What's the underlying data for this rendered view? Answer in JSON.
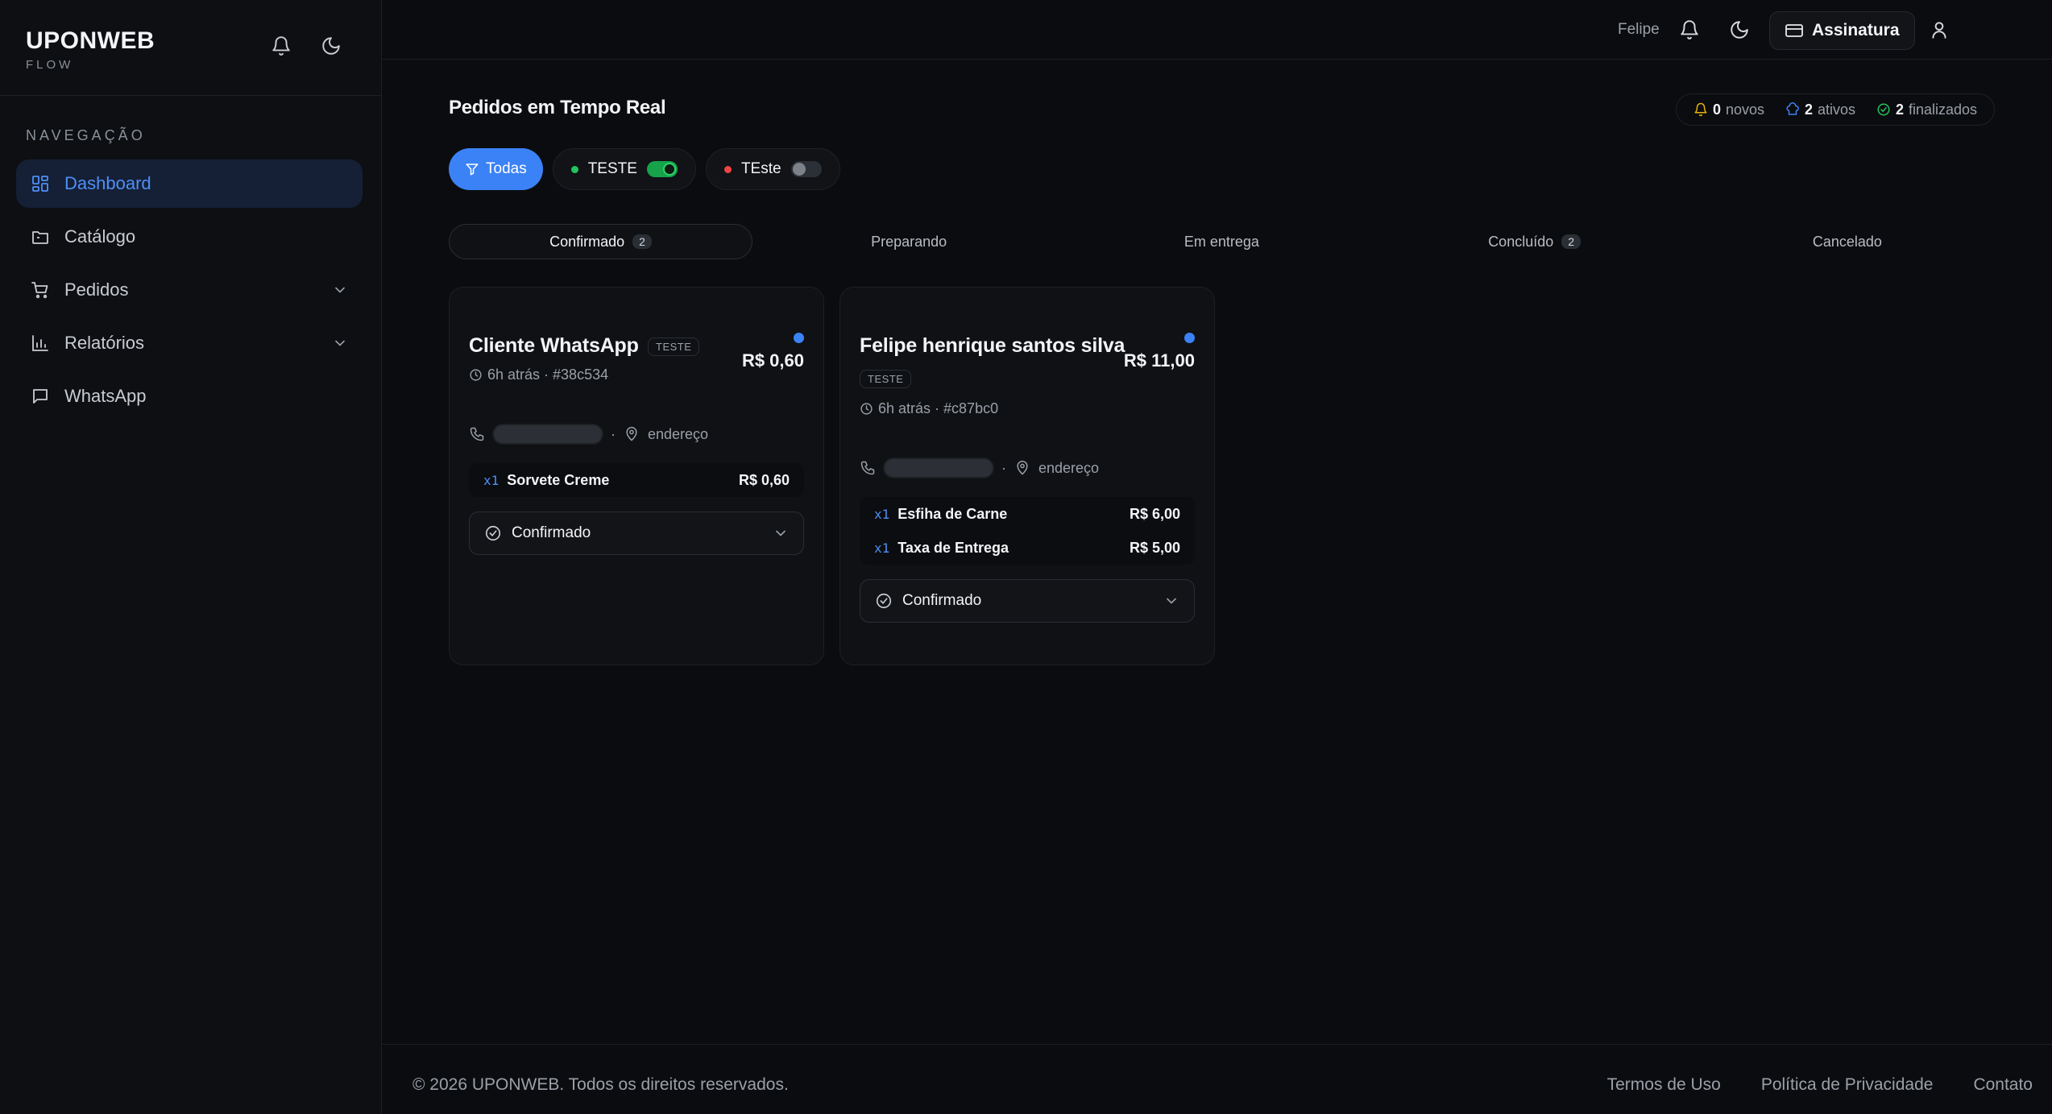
{
  "brand": {
    "name": "UPONWEB",
    "sub": "FLOW"
  },
  "sidebar": {
    "nav_title": "NAVEGAÇÃO",
    "items": [
      {
        "label": "Dashboard",
        "icon": "dashboard-icon",
        "active": true
      },
      {
        "label": "Catálogo",
        "icon": "catalog-icon"
      },
      {
        "label": "Pedidos",
        "icon": "cart-icon",
        "expandable": true
      },
      {
        "label": "Relatórios",
        "icon": "bar-chart-icon",
        "expandable": true
      },
      {
        "label": "WhatsApp",
        "icon": "message-icon"
      }
    ]
  },
  "topbar": {
    "user": "Felipe",
    "subscription": "Assinatura"
  },
  "main": {
    "title": "Pedidos em Tempo Real",
    "stats": {
      "new_count": "0",
      "new_label": "novos",
      "active_count": "2",
      "active_label": "ativos",
      "done_count": "2",
      "done_label": "finalizados"
    },
    "filters": {
      "all": "Todas",
      "chips": [
        {
          "label": "TESTE",
          "dot_color": "#22c55e",
          "enabled": true
        },
        {
          "label": "TEste",
          "dot_color": "#ef4444",
          "enabled": false
        }
      ]
    },
    "tabs": [
      {
        "label": "Confirmado",
        "badge": "2",
        "active": true
      },
      {
        "label": "Preparando"
      },
      {
        "label": "Em entrega"
      },
      {
        "label": "Concluído",
        "badge": "2"
      },
      {
        "label": "Cancelado"
      }
    ]
  },
  "orders": [
    {
      "customer": "Cliente WhatsApp",
      "tag": "TESTE",
      "price": "R$ 0,60",
      "time": "6h atrás · #38c534",
      "address": "endereço",
      "items": [
        {
          "qty": "x1",
          "name": "Sorvete Creme",
          "price": "R$ 0,60"
        }
      ],
      "status": "Confirmado"
    },
    {
      "customer": "Felipe henrique santos silva",
      "tag": "TESTE",
      "price": "R$ 11,00",
      "time": "6h atrás · #c87bc0",
      "address": "endereço",
      "items": [
        {
          "qty": "x1",
          "name": "Esfiha de Carne",
          "price": "R$ 6,00"
        },
        {
          "qty": "x1",
          "name": "Taxa de Entrega",
          "price": "R$ 5,00"
        }
      ],
      "status": "Confirmado"
    }
  ],
  "footer": {
    "copyright": "© 2026 UPONWEB. Todos os direitos reservados.",
    "links": [
      "Termos de Uso",
      "Política de Privacidade",
      "Contato"
    ]
  },
  "colors": {
    "accent": "#3b82f6",
    "success": "#22c55e",
    "danger": "#ef4444",
    "background": "#0b0c0f"
  }
}
